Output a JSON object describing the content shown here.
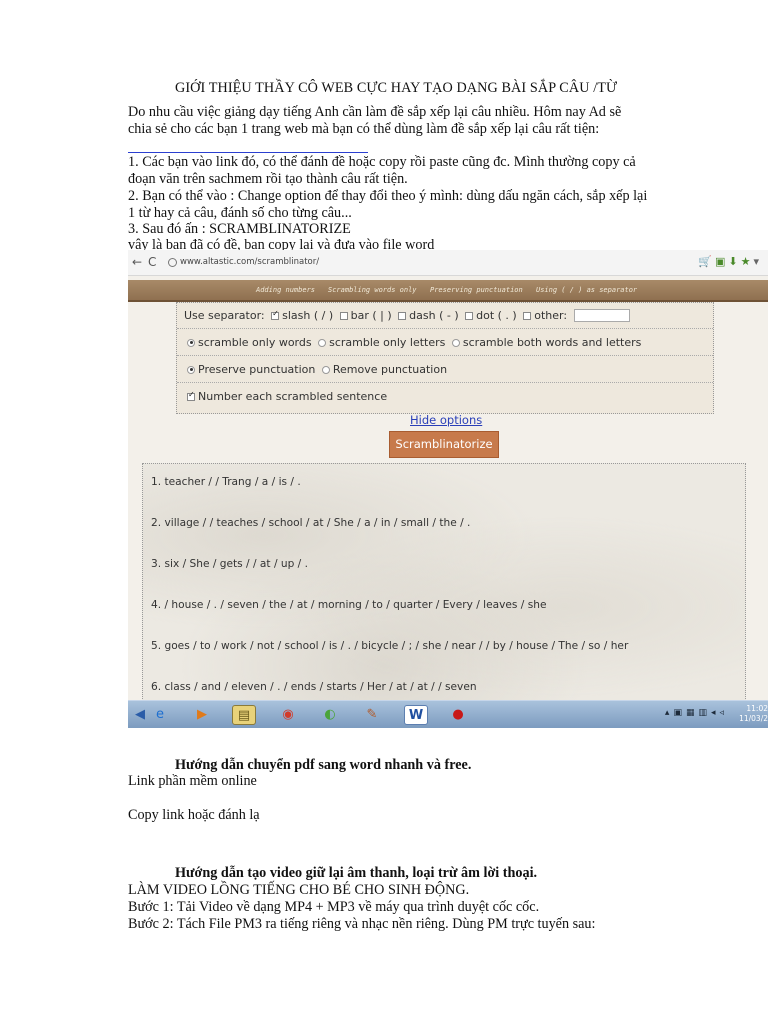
{
  "doc": {
    "title": "GIỚI THIỆU THẦY CÔ WEB CỰC HAY    TẠO DẠNG BÀI SẮP CÂU /TỪ",
    "intro_line1": "Do nhu cầu việc giảng dạy tiếng Anh cần làm đề sắp xếp lại câu nhiều. Hôm nay Ad sẽ",
    "intro_line2": "chia sẻ cho các bạn 1 trang web mà bạn có thể dùng làm đề sắp xếp lại câu rất tiện:",
    "step1_line1": "1. Các bạn vào link đó, có thể đánh đề hoặc copy rồi paste cũng đc. Mình thường copy cả",
    "step1_line2": "đoạn văn trên sachmem rồi tạo thành câu rất tiện.",
    "step2_line1": "2. Bạn có thể vào : Change option để thay đổi theo ý mình: dùng dấu ngăn cách, sắp xếp lại",
    "step2_line2": "1 từ hay cả câu, đánh số cho từng câu...",
    "step3": "3. Sau đó ấn : SCRAMBLINATORIZE",
    "step4": "vậy là bạn đã có đề, bạn copy lại và đưa vào file word",
    "heading2": "Hướng dẫn chuyển pdf sang word nhanh và free.",
    "line_online": "Link phần mềm online",
    "line_copy": "Copy link hoặc đánh lạ",
    "heading3": "Hướng dẫn tạo video giữ lại âm thanh, loại trừ âm lời thoại.",
    "line_video_caps": "LÀM VIDEO LỒNG TIẾNG CHO BÉ CHO SINH ĐỘNG.",
    "line_step1": "Bước 1: Tải Video về dạng MP4 + MP3 về máy qua trình duyệt cốc cốc.",
    "line_step2": "Bước 2: Tách File PM3 ra tiếng riêng và nhạc nền riêng. Dùng PM trực tuyến sau:"
  },
  "browser": {
    "url": "www.altastic.com/scramblinator/",
    "back_icon": "←",
    "reload_icon": "C"
  },
  "banner": {
    "items": [
      "Adding numbers",
      "Scrambling words only",
      "Preserving punctuation",
      "Using ( / ) as separator"
    ]
  },
  "options": {
    "separator_label": "Use separator:",
    "slash": "slash ( / )",
    "bar": "bar ( | )",
    "dash": "dash ( - )",
    "dot": "dot ( . )",
    "other": "other:",
    "scramble_words": "scramble only words",
    "scramble_letters": "scramble only letters",
    "scramble_both": "scramble both words and letters",
    "preserve": "Preserve punctuation",
    "remove": "Remove punctuation",
    "number_each": "Number each scrambled sentence"
  },
  "hide_options": "Hide options",
  "scramble_button": "Scramblinatorize",
  "results": [
    "1. teacher / / Trang / a / is / .",
    "2. village / / teaches / school / at / She / a / in / small / the / .",
    "3. six / She / gets / / at / up / .",
    "4. / house / . / seven / the / at / morning / to / quarter / Every / leaves / she",
    "5. goes / to / work / not / school / is / . / bicycle / ; / she / near / / by / house / The / so / her",
    "6. class / and / eleven / . / ends / starts / Her / at / at / / seven"
  ],
  "taskbar": {
    "clock_time": "11:02",
    "clock_date": "11/03/2"
  }
}
